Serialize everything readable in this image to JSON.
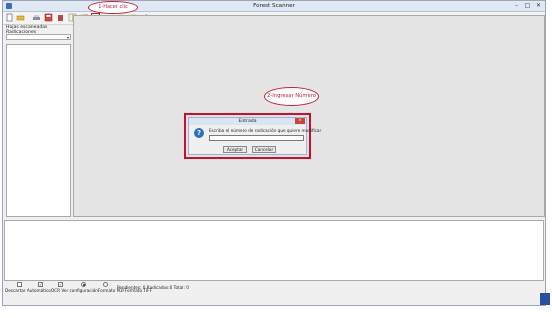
{
  "window": {
    "title": "Forest Scanner"
  },
  "callouts": {
    "step1": "1-Hacer clic",
    "step2": "2-Ingresar Número"
  },
  "sidebar": {
    "section_label": "Hojas escaneadas",
    "combo_label": "Radicaciones",
    "combo_value": ""
  },
  "toolbar": {
    "buttons": [
      {
        "icon": "new-document-icon"
      },
      {
        "icon": "open-folder-icon"
      },
      {
        "icon": "scan-icon"
      },
      {
        "icon": "save-icon"
      },
      {
        "icon": "delete-icon"
      },
      {
        "icon": "grid-icon"
      },
      {
        "icon": "export-icon"
      },
      {
        "icon": "edit-radicacion-icon",
        "selected": true
      },
      {
        "icon": "view-icon"
      },
      {
        "icon": "printer-icon"
      },
      {
        "icon": "printer-alt-icon"
      },
      {
        "icon": "upload-icon"
      }
    ]
  },
  "options": {
    "items": [
      {
        "label": "Descartar Automático",
        "checked": false,
        "kind": "checkbox"
      },
      {
        "label": "OCR",
        "checked": true,
        "kind": "checkbox"
      },
      {
        "label": "Ver configuración",
        "checked": true,
        "kind": "checkbox"
      },
      {
        "label": "Formato PDF",
        "checked": true,
        "kind": "radio"
      },
      {
        "label": "Formato TIFF",
        "checked": false,
        "kind": "radio"
      }
    ],
    "labels_text": "Descartar AutomáticoOCR Ver configuraciónFormato PDFFormato TIFF"
  },
  "status": {
    "text": "Pendientes: 0 Radicados:0 Total: 0"
  },
  "dialog": {
    "title": "Entrada",
    "close_label": "×",
    "message": "Escriba el número de radicación que quiere modificar",
    "input_value": "",
    "accept_label": "Aceptar",
    "cancel_label": "Cancelar"
  },
  "colors": {
    "annotation": "#c31f37",
    "dialog_icon": "#2d6fc1",
    "close_button": "#c9463d"
  }
}
